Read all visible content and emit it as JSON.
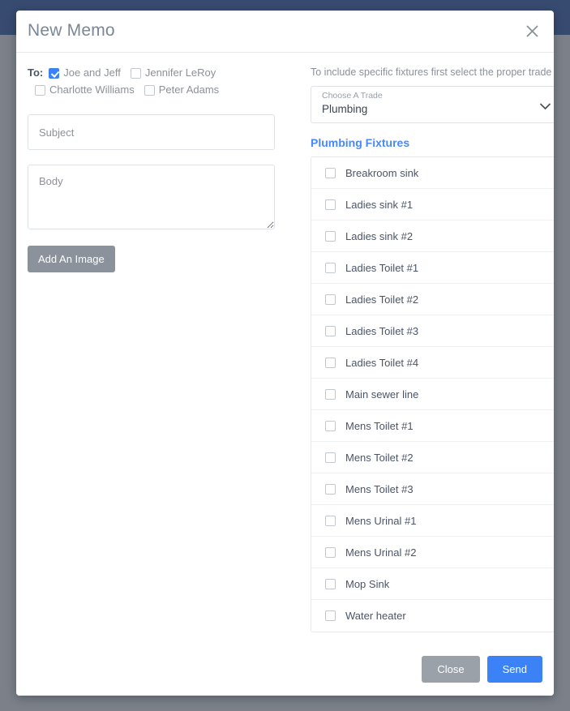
{
  "modal": {
    "title": "New Memo",
    "close_icon": "close-icon"
  },
  "recipients": {
    "to_label": "To:",
    "people": [
      {
        "name": "Joe and Jeff",
        "checked": true
      },
      {
        "name": "Jennifer LeRoy",
        "checked": false
      },
      {
        "name": "Charlotte Williams",
        "checked": false
      },
      {
        "name": "Peter Adams",
        "checked": false
      }
    ]
  },
  "form": {
    "subject_placeholder": "Subject",
    "subject_value": "",
    "body_placeholder": "Body",
    "body_value": "",
    "add_image_label": "Add An Image"
  },
  "fixtures_panel": {
    "hint": "To include specific fixtures first select the proper trade",
    "trade_select": {
      "label": "Choose A Trade",
      "value": "Plumbing",
      "chevron_icon": "chevron-down-icon"
    },
    "heading": "Plumbing Fixtures",
    "items": [
      {
        "label": "Breakroom sink",
        "checked": false
      },
      {
        "label": "Ladies sink #1",
        "checked": false
      },
      {
        "label": "Ladies sink #2",
        "checked": false
      },
      {
        "label": "Ladies Toilet #1",
        "checked": false
      },
      {
        "label": "Ladies Toilet #2",
        "checked": false
      },
      {
        "label": "Ladies Toilet #3",
        "checked": false
      },
      {
        "label": "Ladies Toilet #4",
        "checked": false
      },
      {
        "label": "Main sewer line",
        "checked": false
      },
      {
        "label": "Mens Toilet #1",
        "checked": false
      },
      {
        "label": "Mens Toilet #2",
        "checked": false
      },
      {
        "label": "Mens Toilet #3",
        "checked": false
      },
      {
        "label": "Mens Urinal #1",
        "checked": false
      },
      {
        "label": "Mens Urinal #2",
        "checked": false
      },
      {
        "label": "Mop Sink",
        "checked": false
      },
      {
        "label": "Water heater",
        "checked": false
      }
    ]
  },
  "footer": {
    "close_label": "Close",
    "send_label": "Send"
  },
  "colors": {
    "accent_blue": "#3b82f6",
    "link_blue": "#4a88f7",
    "navbar_navy": "#374a70",
    "overlay_gray": "#7b8089",
    "muted_gray": "#8b929b"
  }
}
